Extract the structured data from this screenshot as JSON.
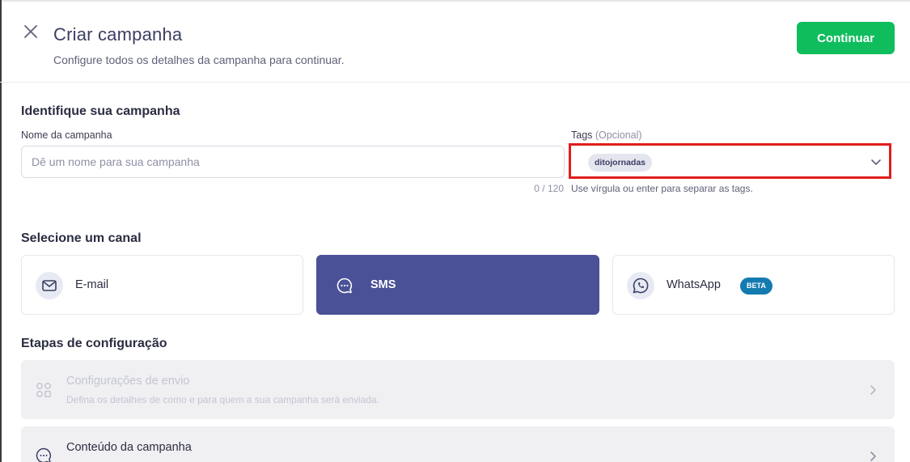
{
  "header": {
    "title": "Criar campanha",
    "subtitle": "Configure todos os detalhes da campanha para continuar.",
    "continue_label": "Continuar"
  },
  "identify": {
    "section_title": "Identifique sua campanha",
    "name_label": "Nome da campanha",
    "name_placeholder": "Dê um nome para sua campanha",
    "name_value": "",
    "counter": "0 / 120",
    "tags_label": "Tags",
    "tags_optional": "(Opcional)",
    "tags": [
      "ditojornadas"
    ],
    "tags_hint": "Use vírgula ou enter para separar as tags."
  },
  "channels": {
    "section_title": "Selecione um canal",
    "selected": "SMS",
    "items": [
      {
        "label": "E-mail",
        "icon": "mail-icon"
      },
      {
        "label": "SMS",
        "icon": "chat-bubble-icon"
      },
      {
        "label": "WhatsApp",
        "icon": "whatsapp-icon",
        "badge": "BETA"
      }
    ]
  },
  "steps": {
    "section_title": "Etapas de configuração",
    "items": [
      {
        "title": "Configurações de envio",
        "description": "Defina os detalhes de como e para quem a sua campanha será enviada.",
        "icon": "grid-icon",
        "state": "disabled"
      },
      {
        "title": "Conteúdo da campanha",
        "icon": "chat-bubble-icon",
        "state": "enabled"
      }
    ]
  },
  "colors": {
    "accent": "#4a5196",
    "primary_button": "#0fbd5c",
    "highlight_border": "#e11c1c",
    "beta_badge": "#147bb0"
  }
}
